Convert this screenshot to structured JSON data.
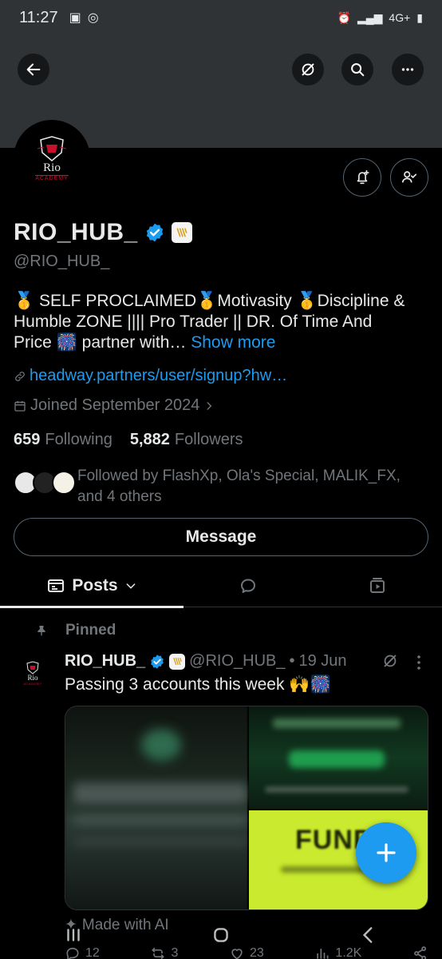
{
  "status_bar": {
    "time": "11:27",
    "network": "4G+"
  },
  "profile": {
    "display_name": "RIO_HUB_",
    "handle": "@RIO_HUB_",
    "avatar_name": "Rio",
    "avatar_sub": "ACADEMY",
    "bio_line1": "🥇 SELF PROCLAIMED🥇Motivasity 🥇Discipline &",
    "bio_line2": "Humble ZONE |||| Pro Trader || DR. Of Time And",
    "bio_line3": "Price 🎆 partner with…",
    "show_more": "Show more",
    "link": "headway.partners/user/signup?hw…",
    "joined": "Joined September 2024",
    "following_count": "659",
    "following_label": "Following",
    "followers_count": "5,882",
    "followers_label": "Followers",
    "followed_by_line1": "Followed by FlashXp, Ola's Special, MALIK_FX,",
    "followed_by_line2": "and 4 others",
    "message_label": "Message"
  },
  "tabs": {
    "posts_label": "Posts"
  },
  "pinned_post": {
    "pinned_label": "Pinned",
    "author": "RIO_HUB_",
    "handle": "@RIO_HUB_",
    "separator": "•",
    "date": "19 Jun",
    "text": "Passing 3 accounts this week 🙌🎆",
    "media_text": "FUNDE",
    "made_with_ai": "Made with AI",
    "replies": "12",
    "reposts": "3",
    "likes": "23",
    "views": "1.2K"
  },
  "colors": {
    "accent": "#1d9bf0",
    "background": "#000000",
    "banner": "#2f3336",
    "muted": "#71767b"
  }
}
